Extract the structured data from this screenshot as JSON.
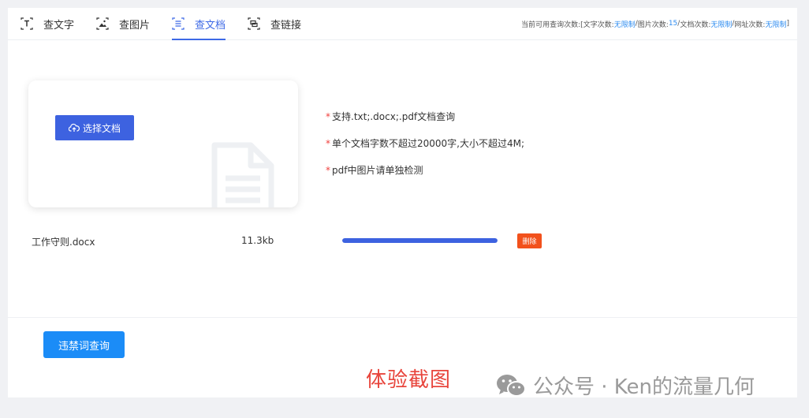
{
  "tabs": [
    {
      "label": "查文字",
      "icon": "text-icon"
    },
    {
      "label": "查图片",
      "icon": "image-icon"
    },
    {
      "label": "查文档",
      "icon": "document-icon",
      "active": true
    },
    {
      "label": "查链接",
      "icon": "link-icon"
    }
  ],
  "quota": {
    "prefix": "当前可用查询次数:[ ",
    "text_label": "文字次数:",
    "text_value": "无限制",
    "sep1": " / ",
    "image_label": "图片次数:",
    "image_value": "15",
    "sep2": " / ",
    "doc_label": "文档次数:",
    "doc_value": "无限制",
    "sep3": " / ",
    "url_label": "网址次数:",
    "url_value": "无限制",
    "suffix": " ]"
  },
  "upload": {
    "button_label": "选择文档",
    "notes": [
      "支持.txt;.docx;.pdf文档查询",
      "单个文档字数不超过20000字,大小不超过4M;",
      "pdf中图片请单独检测"
    ]
  },
  "file": {
    "name": "工作守则.docx",
    "size": "11.3kb",
    "progress": 1.0,
    "delete_label": "删除"
  },
  "query_button": "违禁词查询",
  "caption": "体验截图",
  "watermark": "公众号 · Ken的流量几何",
  "colors": {
    "accent": "#3d69e6",
    "primary_button": "#1b8cf7",
    "delete": "#f2511c",
    "required_star": "#f0413e",
    "caption": "#e8453c"
  }
}
